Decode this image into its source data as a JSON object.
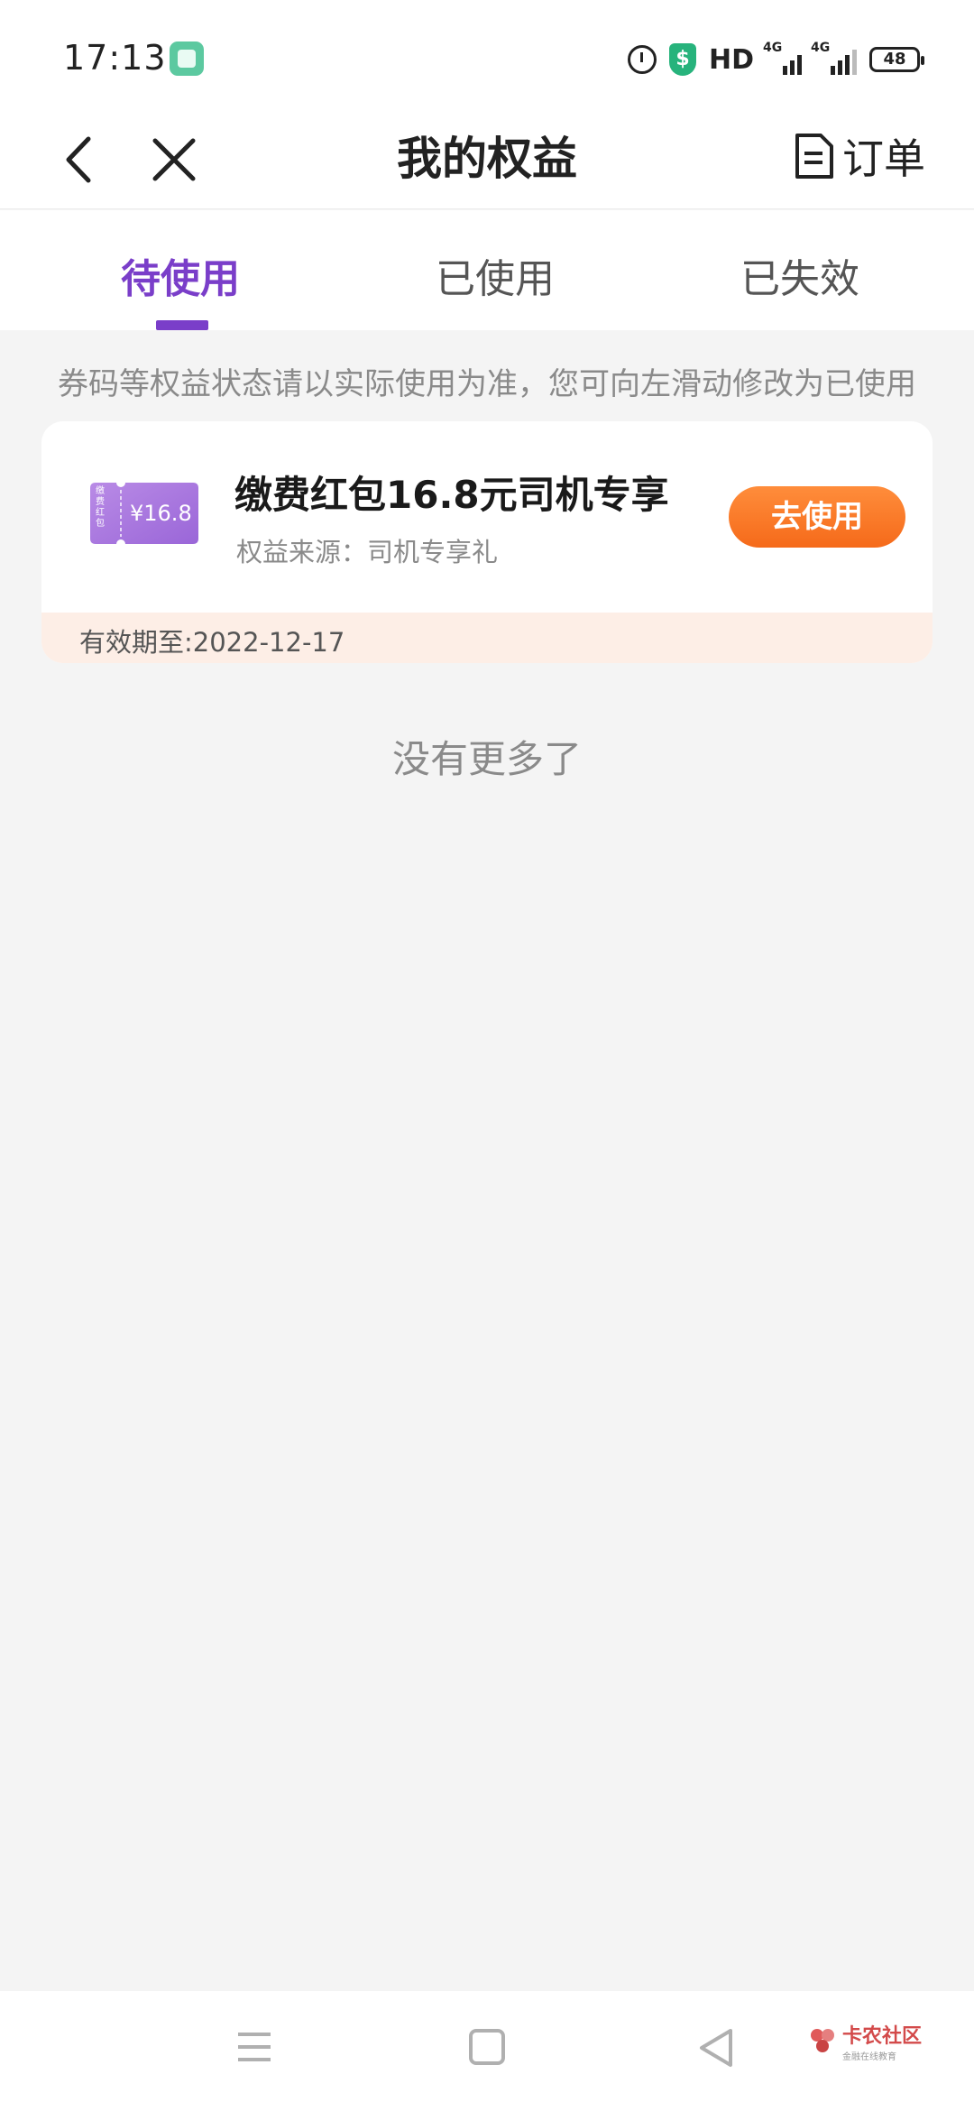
{
  "status_bar": {
    "time": "17:13",
    "hd": "HD",
    "network_1": "4G",
    "network_2": "4G",
    "battery": "48"
  },
  "nav": {
    "title": "我的权益",
    "orders_label": "订单"
  },
  "tabs": [
    {
      "label": "待使用",
      "active": true
    },
    {
      "label": "已使用",
      "active": false
    },
    {
      "label": "已失效",
      "active": false
    }
  ],
  "hint": "券码等权益状态请以实际使用为准，您可向左滑动修改为已使用",
  "coupon": {
    "icon_text_left": "缴费红包",
    "icon_value": "¥16.8",
    "title": "缴费红包16.8元司机专享",
    "source": "权益来源：司机专享礼",
    "button_label": "去使用",
    "expiry": "有效期至:2022-12-17"
  },
  "no_more": "没有更多了",
  "watermark": {
    "title": "卡农社区",
    "subtitle": "金融在线教育"
  },
  "colors": {
    "accent": "#7a3ec9",
    "button": "#f56a1a",
    "card_footer": "#fdeee6",
    "background": "#f4f4f4"
  }
}
